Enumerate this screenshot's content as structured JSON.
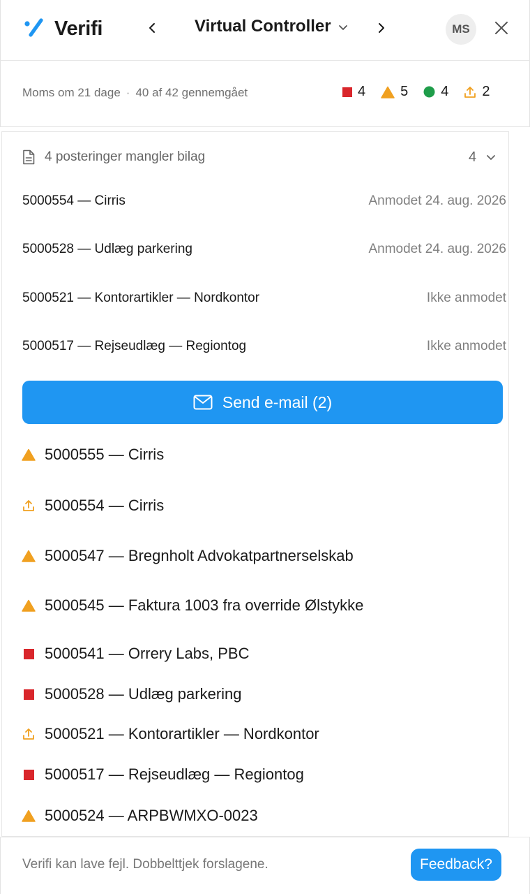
{
  "app": {
    "name": "Verifi",
    "title": "Virtual Controller",
    "avatar_initials": "MS"
  },
  "icons": {
    "logo": "verifi-logo-icon",
    "prev": "chevron-left-icon",
    "next": "chevron-right-icon",
    "title_dropdown": "chevron-down-icon",
    "close": "close-icon",
    "missing": "document-icon",
    "send": "mail-icon"
  },
  "colors": {
    "accent": "#1f96f2",
    "error": "#d9262b",
    "warning": "#f0a020",
    "ok": "#1f9d4a",
    "upload": "#f0a020"
  },
  "status": {
    "due": "Moms om 21 dage",
    "separator": "·",
    "reviewed": "40 af 42 gennemgået",
    "counts": [
      {
        "type": "error",
        "value": "4"
      },
      {
        "type": "warning",
        "value": "5"
      },
      {
        "type": "ok",
        "value": "4"
      },
      {
        "type": "upload",
        "value": "2"
      }
    ]
  },
  "missing": {
    "title": "4 posteringer mangler bilag",
    "count": "4",
    "items": [
      {
        "name": "5000554 — Cirris",
        "state": "Anmodet 24. aug. 2026"
      },
      {
        "name": "5000528 — Udlæg parkering",
        "state": "Anmodet 24. aug. 2026"
      },
      {
        "name": "5000521 — Kontorartikler — Nordkontor",
        "state": "Ikke anmodet"
      },
      {
        "name": "5000517 — Rejseudlæg — Regiontog",
        "state": "Ikke anmodet"
      }
    ],
    "send_label": "Send e-mail (2)"
  },
  "issues": [
    {
      "type": "warning",
      "label": "5000555 — Cirris"
    },
    {
      "type": "upload",
      "label": "5000554 — Cirris"
    },
    {
      "type": "warning",
      "label": "5000547 — Bregnholt Advokatpartnerselskab"
    },
    {
      "type": "warning",
      "label": "5000545 — Faktura 1003 fra override Ølstykke"
    },
    {
      "type": "error",
      "label": "5000541 — Orrery Labs, PBC"
    },
    {
      "type": "error",
      "label": "5000528 — Udlæg parkering"
    },
    {
      "type": "upload",
      "label": "5000521 — Kontorartikler — Nordkontor"
    },
    {
      "type": "error",
      "label": "5000517 — Rejseudlæg — Regiontog"
    },
    {
      "type": "warning",
      "label": "5000524 — ARPBWMXO-0023"
    }
  ],
  "footer": {
    "disclaimer": "Verifi kan lave fejl. Dobbelttjek forslagene.",
    "feedback_label": "Feedback?"
  }
}
